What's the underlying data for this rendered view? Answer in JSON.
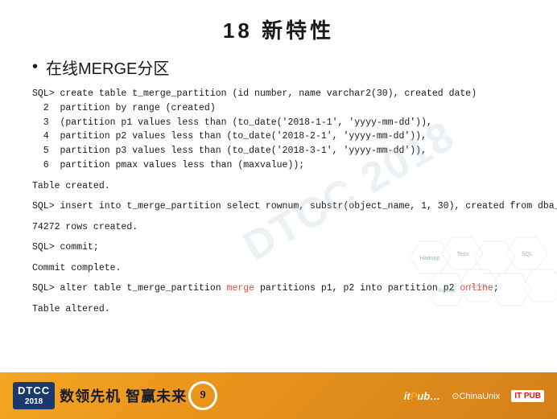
{
  "slide": {
    "title": "18  新特性",
    "section": "在线MERGE分区",
    "watermark": "DTCC 2018",
    "code_blocks": [
      {
        "id": "create_table",
        "lines": [
          {
            "type": "prompt",
            "text": "SQL> create table t_merge_partition (id number, name varchar2(30), created date)"
          },
          {
            "type": "code",
            "text": "  2  partition by range (created)"
          },
          {
            "type": "code",
            "text": "  3  (partition p1 values less than (to_date('2018-1-1', 'yyyy-mm-dd')),"
          },
          {
            "type": "code",
            "text": "  4  partition p2 values less than (to_date('2018-2-1', 'yyyy-mm-dd')),"
          },
          {
            "type": "code",
            "text": "  5  partition p3 values less than (to_date('2018-3-1', 'yyyy-mm-dd')),"
          },
          {
            "type": "code",
            "text": "  6  partition pmax values less than (maxvalue));"
          }
        ]
      },
      {
        "id": "table_created_1",
        "lines": [
          {
            "type": "status",
            "text": "Table created."
          }
        ]
      },
      {
        "id": "insert",
        "lines": [
          {
            "type": "prompt",
            "text": "SQL> insert into t_merge_partition select rownum, substr(object_name, 1, 30), created from dba_objects;"
          }
        ]
      },
      {
        "id": "rows_created",
        "lines": [
          {
            "type": "status",
            "text": "74272 rows created."
          }
        ]
      },
      {
        "id": "commit",
        "lines": [
          {
            "type": "prompt",
            "text": "SQL> commit;"
          }
        ]
      },
      {
        "id": "commit_complete",
        "lines": [
          {
            "type": "status",
            "text": "Commit complete."
          }
        ]
      },
      {
        "id": "alter_merge",
        "lines": [
          {
            "type": "prompt_merge",
            "text_before": "SQL> alter table t_merge_partition ",
            "keyword1": "merge",
            "text_middle": " partitions p1, p2 into partition p2 ",
            "keyword2": "online",
            "text_after": ";"
          }
        ]
      },
      {
        "id": "table_altered",
        "lines": [
          {
            "type": "status",
            "text": "Table altered."
          }
        ]
      }
    ],
    "footer": {
      "year": "2018",
      "dtcc": "DTCC",
      "slogan": "数领先机 智赢未来",
      "circle_label": "9",
      "sponsors": [
        {
          "name": "itpub",
          "label": "IT PUB"
        },
        {
          "name": "chinaunix",
          "label": "⊙ChinaUnix"
        },
        {
          "name": "aitpub",
          "label": "IT PUB"
        }
      ]
    },
    "hex_labels": [
      "Hadoop",
      "Tess",
      "BigData",
      "NoSQL",
      "SQL"
    ]
  }
}
